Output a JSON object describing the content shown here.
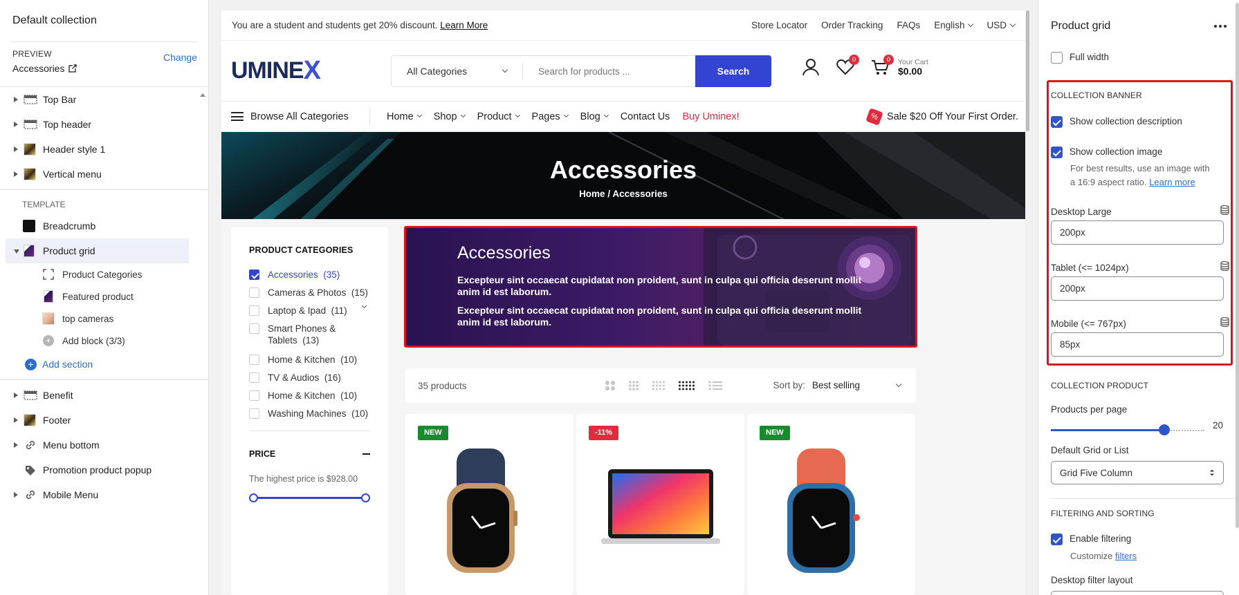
{
  "left_panel": {
    "title": "Default collection",
    "preview_label": "PREVIEW",
    "preview_value": "Accessories",
    "change_label": "Change",
    "header_items": [
      {
        "label": "Top Bar",
        "icon": "layout-icon"
      },
      {
        "label": "Top header",
        "icon": "layout-icon"
      },
      {
        "label": "Header style 1",
        "icon": "thumbnail-icon"
      },
      {
        "label": "Vertical menu",
        "icon": "thumbnail-icon"
      }
    ],
    "template_label": "TEMPLATE",
    "template_items": [
      {
        "label": "Breadcrumb",
        "icon": "thumbnail-icon"
      },
      {
        "label": "Product grid",
        "icon": "thumbnail-icon"
      }
    ],
    "blocks": [
      {
        "label": "Product Categories",
        "icon": "block-icon"
      },
      {
        "label": "Featured product",
        "icon": "thumbnail-icon"
      },
      {
        "label": "top cameras",
        "icon": "thumbnail-icon"
      }
    ],
    "add_block": "Add block (3/3)",
    "add_section": "Add section",
    "footer_items": [
      {
        "label": "Benefit",
        "icon": "layout-icon"
      },
      {
        "label": "Footer",
        "icon": "thumbnail-icon"
      },
      {
        "label": "Menu bottom",
        "icon": "link-icon"
      },
      {
        "label": "Promotion product popup",
        "icon": "tag-icon"
      },
      {
        "label": "Mobile Menu",
        "icon": "link-icon"
      }
    ]
  },
  "store": {
    "topbar": {
      "promo": "You are a student and students get 20% discount.",
      "learn_more": "Learn More",
      "links": [
        "Store Locator",
        "Order Tracking",
        "FAQs"
      ],
      "language": "English",
      "currency": "USD"
    },
    "header": {
      "logo_main": "UMINE",
      "logo_x": "X",
      "category_select": "All Categories",
      "search_placeholder": "Search for products ...",
      "search_button": "Search",
      "wishlist_count": "0",
      "cart_count": "0",
      "cart_label": "Your Cart",
      "cart_total": "$0.00"
    },
    "nav": {
      "browse": "Browse All Categories",
      "items": [
        "Home",
        "Shop",
        "Product",
        "Pages",
        "Blog"
      ],
      "contact": "Contact Us",
      "buy": "Buy Uminex!",
      "sale": "Sale $20 Off Your First Order."
    },
    "hero": {
      "title": "Accessories",
      "breadcrumb_home": "Home",
      "breadcrumb_sep": "/",
      "breadcrumb_current": "Accessories"
    },
    "filter": {
      "heading": "PRODUCT CATEGORIES",
      "categories": [
        {
          "name": "Accessories",
          "count": "(35)",
          "checked": true
        },
        {
          "name": "Cameras & Photos",
          "count": "(15)",
          "checked": false
        },
        {
          "name": "Laptop & Ipad",
          "count": "(11)",
          "checked": false
        },
        {
          "name": "Smart Phones & Tablets",
          "count": "(13)",
          "checked": false
        },
        {
          "name": "Home & Kitchen",
          "count": "(10)",
          "checked": false
        },
        {
          "name": "TV & Audios",
          "count": "(16)",
          "checked": false
        },
        {
          "name": "Home & Kitchen",
          "count": "(10)",
          "checked": false
        },
        {
          "name": "Washing Machines",
          "count": "(10)",
          "checked": false
        }
      ],
      "price_heading": "PRICE",
      "price_note": "The highest price is $928.00"
    },
    "banner": {
      "title": "Accessories",
      "paragraphs": [
        "Excepteur sint occaecat cupidatat non proident, sunt in culpa qui officia deserunt mollit anim id est laborum.",
        "Excepteur sint occaecat cupidatat non proident, sunt in culpa qui officia deserunt mollit anim id est laborum."
      ]
    },
    "toolbar": {
      "count": "35 products",
      "sort_label": "Sort by:",
      "sort_value": "Best selling"
    },
    "products": [
      {
        "tag": "NEW",
        "tag_color": "#1a8a2e",
        "image": "apple-watch-navy"
      },
      {
        "tag": "-11%",
        "tag_color": "#e02c3c",
        "image": "macbook"
      },
      {
        "tag": "NEW",
        "tag_color": "#1a8a2e",
        "image": "apple-watch-orange"
      }
    ]
  },
  "right_panel": {
    "title": "Product grid",
    "full_width": "Full width",
    "collection_banner_heading": "COLLECTION BANNER",
    "show_description": "Show collection description",
    "show_image": "Show collection image",
    "image_help": "For best results, use an image with a 16:9 aspect ratio.",
    "image_help_link": "Learn more",
    "desktop_large_label": "Desktop Large",
    "desktop_large_value": "200px",
    "tablet_label": "Tablet (<= 1024px)",
    "tablet_value": "200px",
    "mobile_label": "Mobile (<= 767px)",
    "mobile_value": "85px",
    "collection_product_heading": "COLLECTION PRODUCT",
    "products_per_page_label": "Products per page",
    "products_per_page_value": "20",
    "default_grid_label": "Default Grid or List",
    "default_grid_value": "Grid Five Column",
    "filtering_heading": "FILTERING AND SORTING",
    "enable_filtering": "Enable filtering",
    "customize_prefix": "Customize",
    "customize_link": "filters",
    "desktop_filter_layout": "Desktop filter layout"
  },
  "colors": {
    "accent_blue": "#3344d3",
    "editor_blue": "#2f55c8",
    "highlight_red": "#e00f1c",
    "sale_red": "#e02c3c"
  }
}
